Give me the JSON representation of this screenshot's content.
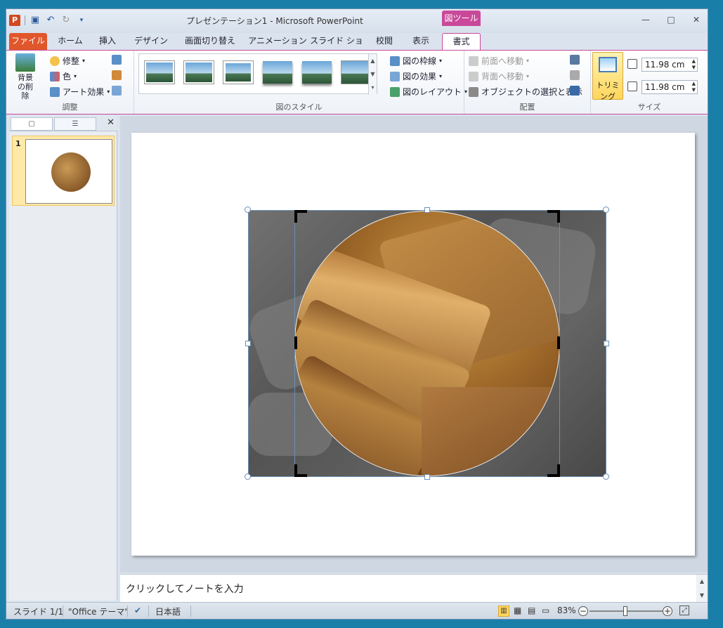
{
  "window": {
    "title": "プレゼンテーション1 - Microsoft PowerPoint",
    "context_tool": "図ツール",
    "qat": {
      "app_icon": "powerpoint-icon",
      "save": "save-icon",
      "undo": "undo-icon",
      "redo": "redo-icon"
    },
    "controls": {
      "minimize": "—",
      "restore": "□",
      "close": "✕"
    }
  },
  "tabs": [
    "ファイル",
    "ホーム",
    "挿入",
    "デザイン",
    "画面切り替え",
    "アニメーション",
    "スライド ショー",
    "校閲",
    "表示",
    "書式"
  ],
  "ribbon": {
    "adjust": {
      "remove_bg": "背景の削除",
      "corrections": "修整",
      "color": "色",
      "artistic": "アート効果",
      "label": "調整"
    },
    "styles": {
      "border": "図の枠線",
      "effects": "図の効果",
      "layout": "図のレイアウト",
      "label": "図のスタイル"
    },
    "arrange": {
      "forward": "前面へ移動",
      "backward": "背面へ移動",
      "selection": "オブジェクトの選択と表示",
      "label": "配置"
    },
    "size": {
      "crop": "トリミング",
      "height": "11.98 cm",
      "width": "11.98 cm",
      "label": "サイズ"
    }
  },
  "left_pane": {
    "slide_number": "1"
  },
  "notes": {
    "placeholder": "クリックしてノートを入力"
  },
  "status": {
    "slide": "スライド 1/1",
    "theme": "\"Office テーマ\"",
    "language": "日本語",
    "zoom": "83%"
  },
  "colors": {
    "accent": "#c9489a",
    "file_tab": "#e0572b",
    "selection": "#6b8fb5"
  }
}
